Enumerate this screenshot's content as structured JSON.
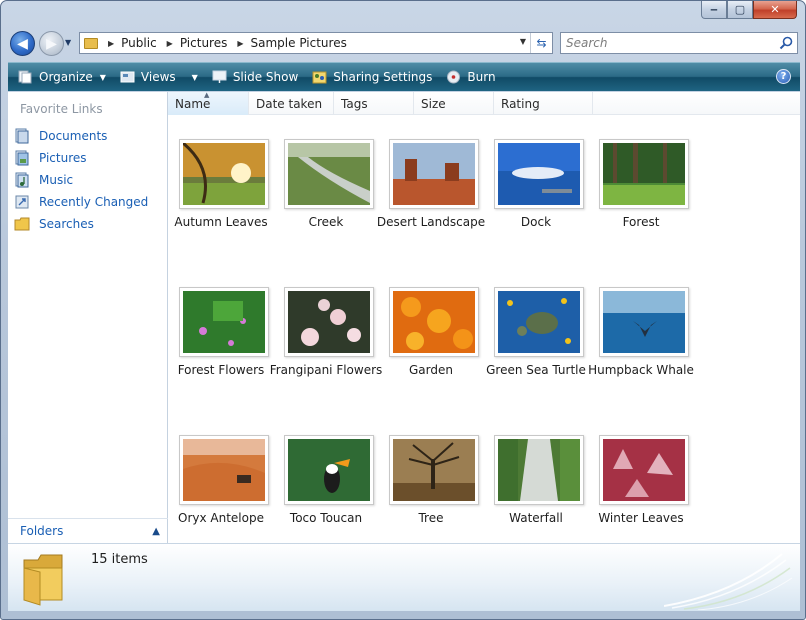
{
  "window": {
    "caption_buttons": {
      "minimize": "‒",
      "maximize": "▢",
      "close": "✕"
    }
  },
  "address": {
    "crumbs": [
      "Public",
      "Pictures",
      "Sample Pictures"
    ]
  },
  "search": {
    "placeholder": "Search"
  },
  "toolbar": {
    "organize": "Organize",
    "views": "Views",
    "slideshow": "Slide Show",
    "sharing": "Sharing Settings",
    "burn": "Burn",
    "help": "?"
  },
  "navpane": {
    "title": "Favorite Links",
    "links": [
      "Documents",
      "Pictures",
      "Music",
      "Recently Changed",
      "Searches"
    ],
    "folders_label": "Folders"
  },
  "columns": [
    "Name",
    "Date taken",
    "Tags",
    "Size",
    "Rating"
  ],
  "items": [
    {
      "label": "Autumn Leaves"
    },
    {
      "label": "Creek"
    },
    {
      "label": "Desert Landscape"
    },
    {
      "label": "Dock"
    },
    {
      "label": "Forest"
    },
    {
      "label": "Forest Flowers"
    },
    {
      "label": "Frangipani Flowers"
    },
    {
      "label": "Garden"
    },
    {
      "label": "Green Sea Turtle"
    },
    {
      "label": "Humpback Whale"
    },
    {
      "label": "Oryx Antelope"
    },
    {
      "label": "Toco Toucan"
    },
    {
      "label": "Tree"
    },
    {
      "label": "Waterfall"
    },
    {
      "label": "Winter Leaves"
    }
  ],
  "details": {
    "count_text": "15 items"
  },
  "colors": {
    "link": "#1a5fb4",
    "toolbar": "#2b6a86",
    "accent": "#2e6ac8"
  }
}
